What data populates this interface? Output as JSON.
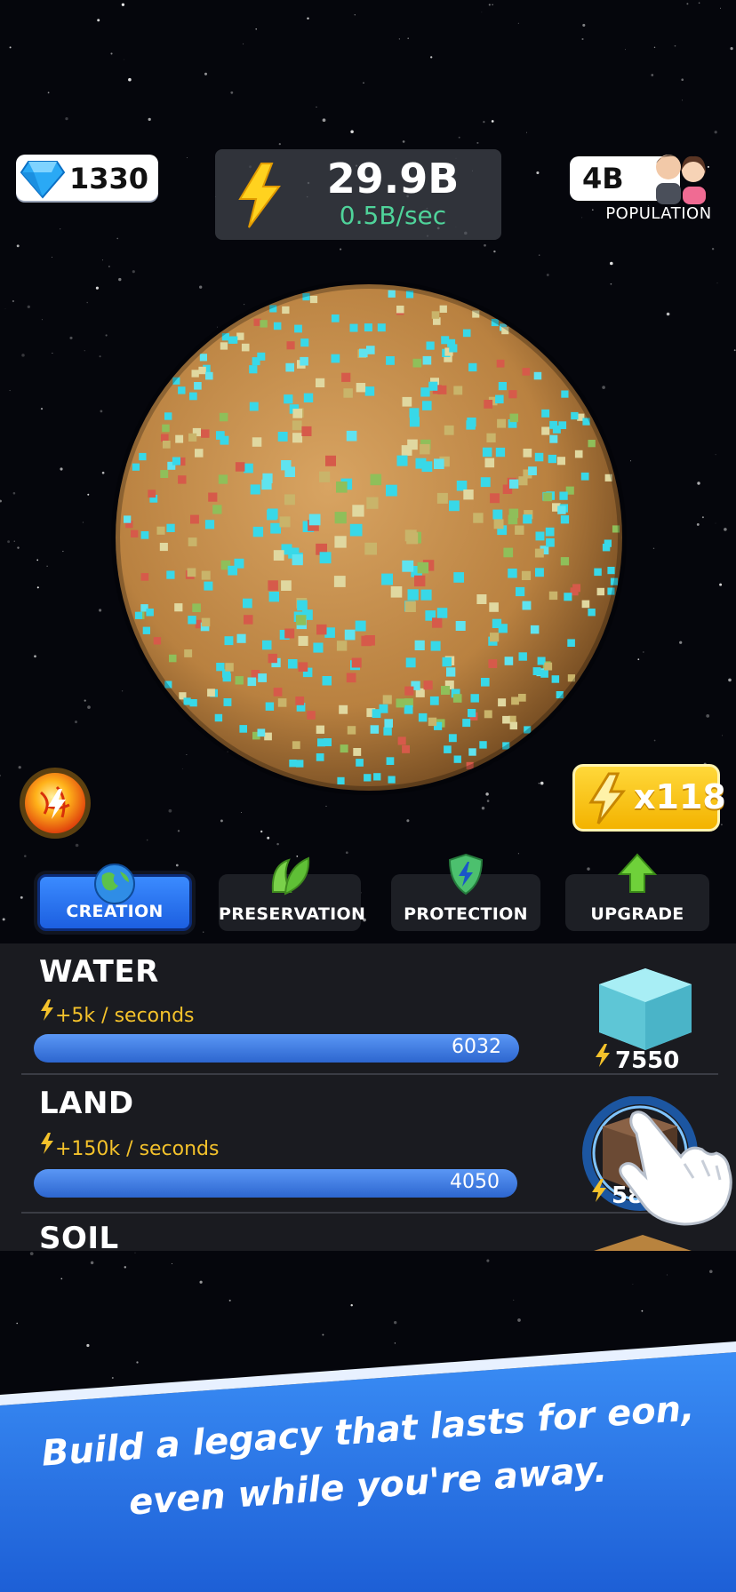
{
  "hud": {
    "gems": "1330",
    "energy_total": "29.9B",
    "energy_rate": "0.5B/sec",
    "population_value": "4B",
    "population_label": "POPULATION"
  },
  "multiplier": {
    "label": "x118"
  },
  "tabs": [
    {
      "label": "CREATION",
      "icon": "earth-icon",
      "active": true
    },
    {
      "label": "PRESERVATION",
      "icon": "leaf-icon",
      "active": false
    },
    {
      "label": "PROTECTION",
      "icon": "shield-icon",
      "active": false
    },
    {
      "label": "UPGRADE",
      "icon": "arrow-up-icon",
      "active": false
    }
  ],
  "elements": [
    {
      "name": "WATER",
      "rate": "+5k / seconds",
      "progress_value": "6032",
      "cost": "7550"
    },
    {
      "name": "LAND",
      "rate": "+150k / seconds",
      "progress_value": "4050",
      "cost": "58"
    },
    {
      "name": "SOIL"
    }
  ],
  "banner": {
    "line1": "Build a legacy that lasts for eon,",
    "line2": "even while you're away."
  },
  "colors": {
    "accent_blue": "#2d66cf",
    "energy_yellow": "#f4c22b",
    "rate_green": "#4fd39a",
    "planet_sand": "#c8924e",
    "water_cyan": "#38d8e8"
  }
}
